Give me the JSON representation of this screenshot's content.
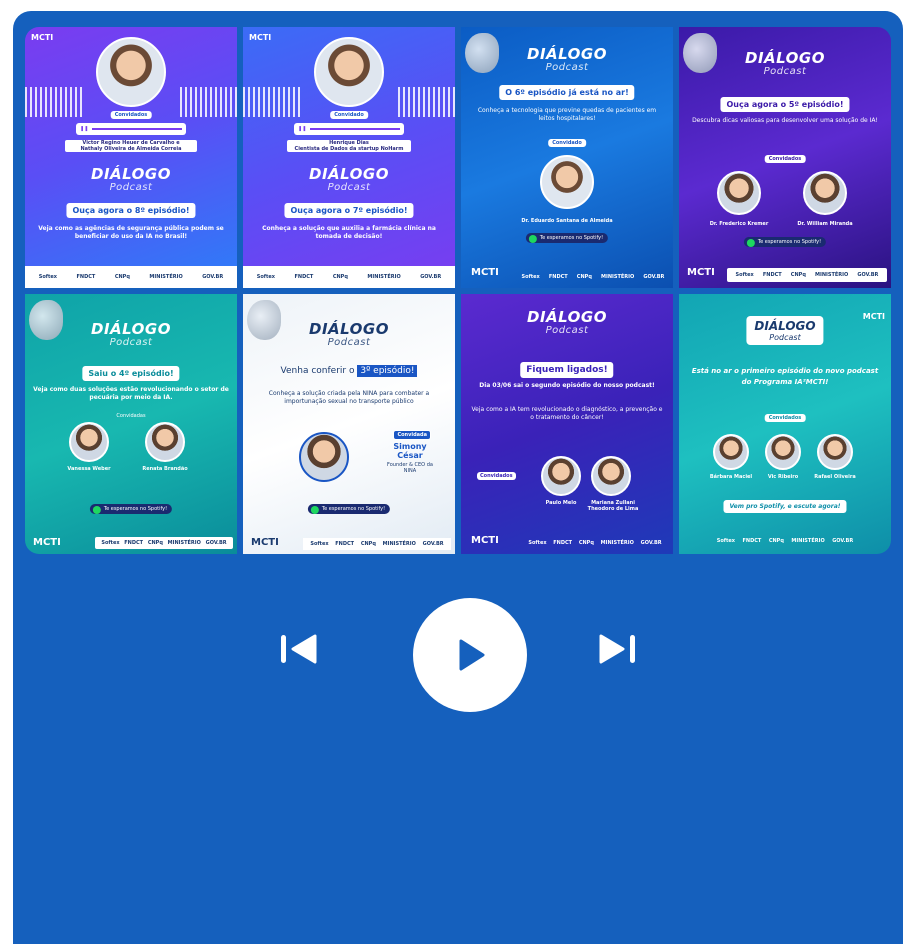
{
  "colors": {
    "panel": "#1560bd",
    "control": "#ffffff",
    "play_icon": "#1560bd"
  },
  "cards": [
    {
      "badge": "MCTI",
      "guest_label": "Convidados",
      "guests": "Victor Regino Heuer de Carvalho e\nNathaly Oliveira de Almeida Correia",
      "logo": "DIÁLOGO",
      "logo_sub": "Podcast",
      "headline": "Ouça agora o 8º episódio!",
      "description": "Veja como as agências de segurança pública podem se beneficiar do uso da IA no Brasil!",
      "footer": [
        "Softex",
        "FNDCT",
        "CNPq",
        "MINISTÉRIO",
        "GOV.BR"
      ]
    },
    {
      "badge": "MCTI",
      "guest_label": "Convidado",
      "guests": "Henrique Dias\nCientista de Dados da startup NoHarm",
      "logo": "DIÁLOGO",
      "logo_sub": "Podcast",
      "headline": "Ouça agora o 7º episódio!",
      "description": "Conheça a solução que auxilia a farmácia clínica na tomada de decisão!",
      "footer": [
        "Softex",
        "FNDCT",
        "CNPq",
        "MINISTÉRIO",
        "GOV.BR"
      ]
    },
    {
      "logo": "DIÁLOGO",
      "logo_sub": "Podcast",
      "headline": "O 6º episódio já está no ar!",
      "description": "Conheça a tecnologia que previne quedas de pacientes em leitos hospitalares!",
      "guest_label": "Convidado",
      "guests": "Dr. Eduardo Santana de Almeida",
      "spotify": "Te esperamos no Spotify!",
      "badge": "MCTI",
      "footer": [
        "Softex",
        "FNDCT",
        "CNPq",
        "MINISTÉRIO",
        "GOV.BR"
      ]
    },
    {
      "logo": "DIÁLOGO",
      "logo_sub": "Podcast",
      "headline": "Ouça agora o 5º episódio!",
      "description": "Descubra dicas valiosas para desenvolver uma solução de IA!",
      "guest_label": "Convidados",
      "guest_names": [
        "Dr. Frederico Kremer",
        "Dr. William Miranda"
      ],
      "spotify": "Te esperamos no Spotify!",
      "badge": "MCTI",
      "footer": [
        "Softex",
        "FNDCT",
        "CNPq",
        "MINISTÉRIO",
        "GOV.BR"
      ]
    },
    {
      "logo": "DIÁLOGO",
      "logo_sub": "Podcast",
      "headline": "Saiu o 4º episódio!",
      "description": "Veja como duas soluções estão revolucionando o setor de pecuária por meio da IA.",
      "guest_label": "Convidadas",
      "guest_names": [
        "Vanessa Weber",
        "Renata Brandão"
      ],
      "spotify": "Te esperamos no Spotify!",
      "badge": "MCTI",
      "footer": [
        "Softex",
        "FNDCT",
        "CNPq",
        "MINISTÉRIO",
        "GOV.BR"
      ]
    },
    {
      "logo": "DIÁLOGO",
      "logo_sub": "Podcast",
      "headline_prefix": "Venha conferir o",
      "headline_highlight": "3º episódio!",
      "description": "Conheça a solução criada pela NINA para combater a importunação sexual no transporte público",
      "guest_label": "Convidada",
      "guest_name": "Simony César",
      "guest_role": "Founder & CEO da NINA",
      "spotify": "Te esperamos no Spotify!",
      "badge": "MCTI",
      "footer": [
        "Softex",
        "FNDCT",
        "CNPq",
        "MINISTÉRIO",
        "GOV.BR"
      ]
    },
    {
      "logo": "DIÁLOGO",
      "logo_sub": "Podcast",
      "headline": "Fiquem ligados!",
      "subhead": "Dia 03/06 sai o segundo episódio do nosso podcast!",
      "description": "Veja como a IA tem revolucionado o diagnóstico, a prevenção e o tratamento do câncer!",
      "guest_label": "Convidados",
      "guest_names": [
        "Paulo Melo",
        "Mariana Zullani Theodoro de Lima"
      ],
      "badge": "MCTI",
      "footer": [
        "Softex",
        "FNDCT",
        "CNPq",
        "MINISTÉRIO",
        "GOV.BR"
      ]
    },
    {
      "logo": "DIÁLOGO",
      "logo_sub": "Podcast",
      "badge": "MCTI",
      "headline": "Está no ar o primeiro episódio do novo podcast do Programa IA²MCTI!",
      "guest_label": "Convidados",
      "guest_names": [
        "Bárbara Maciel",
        "Vic Ribeiro",
        "Rafael Oliveira"
      ],
      "cta": "Vem pro Spotify, e escute agora!",
      "footer": [
        "Softex",
        "FNDCT",
        "CNPq",
        "MINISTÉRIO",
        "GOV.BR"
      ]
    }
  ],
  "player": {
    "prev_icon": "skip-previous-icon",
    "play_icon": "play-icon",
    "next_icon": "skip-next-icon"
  }
}
